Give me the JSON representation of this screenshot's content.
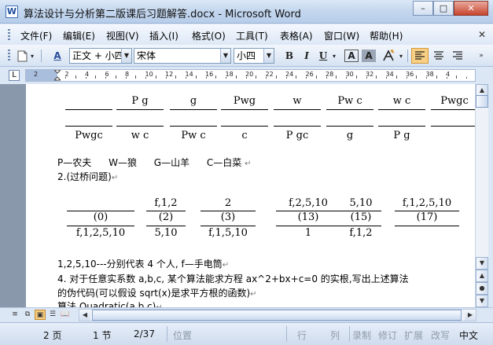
{
  "window": {
    "title": "算法设计与分析第二版课后习题解答.docx - Microsoft Word",
    "app_icon": "W",
    "minimize": "–",
    "maximize": "□",
    "close": "✕"
  },
  "menu": {
    "items": [
      "文件(F)",
      "编辑(E)",
      "视图(V)",
      "插入(I)",
      "格式(O)",
      "工具(T)",
      "表格(A)",
      "窗口(W)",
      "帮助(H)"
    ],
    "close_doc": "✕"
  },
  "toolbar": {
    "style_box": "正文 + 小四",
    "font_box": "宋体",
    "size_box": "小四",
    "bold": "B",
    "italic": "I",
    "underline": "U",
    "border_char": "A",
    "shade_char": "A",
    "style_icon_text": "A",
    "highlight_color": "#d9a634"
  },
  "ruler": {
    "numbers": [
      "2",
      "2",
      "4",
      "6",
      "8",
      "10",
      "12",
      "14",
      "16",
      "18",
      "20",
      "22",
      "24",
      "26",
      "28",
      "30",
      "32",
      "34",
      "36",
      "38",
      "4"
    ]
  },
  "document": {
    "row1_top": [
      "P g",
      "g",
      "Pwg",
      "w",
      "Pw c",
      "w c",
      "Pwgc"
    ],
    "row1_bottom": [
      "Pwgc",
      "w c",
      "Pw c",
      "c",
      "P gc",
      "g",
      "P g"
    ],
    "legend": [
      "P—农夫",
      "W—狼",
      "G—山羊",
      "C—白菜"
    ],
    "q2_title": "2.(过桥问题)",
    "bridge": [
      {
        "top": "",
        "mid": "(0)",
        "bottom": "f,1,2,5,10"
      },
      {
        "top": "f,1,2",
        "mid": "(2)",
        "bottom": "5,10"
      },
      {
        "top": "2",
        "mid": "(3)",
        "bottom": "f,1,5,10"
      },
      {
        "top": "f,2,5,10",
        "mid": "(13)",
        "bottom": "1"
      },
      {
        "top": "5,10",
        "mid": "(15)",
        "bottom": "f,1,2"
      },
      {
        "top": "f,1,2,5,10",
        "mid": "(17)",
        "bottom": ""
      }
    ],
    "note": "1,2,5,10---分别代表 4 个人, f—手电筒",
    "q4_line1": "4.  对于任意实系数 a,b,c, 某个算法能求方程 ax^2+bx+c=0 的实根,写出上述算法",
    "q4_line2": "的伪代码(可以假设 sqrt(x)是求平方根的函数)",
    "q4_line3": "算法 Quadratic(a,b,c)"
  },
  "status": {
    "page": "2 页",
    "section": "1 节",
    "pages": "2/37",
    "position": "位置",
    "line": "行",
    "column": "列",
    "record": "录制",
    "revise": "修订",
    "extend": "扩展",
    "overwrite": "改写",
    "language": "中文"
  }
}
